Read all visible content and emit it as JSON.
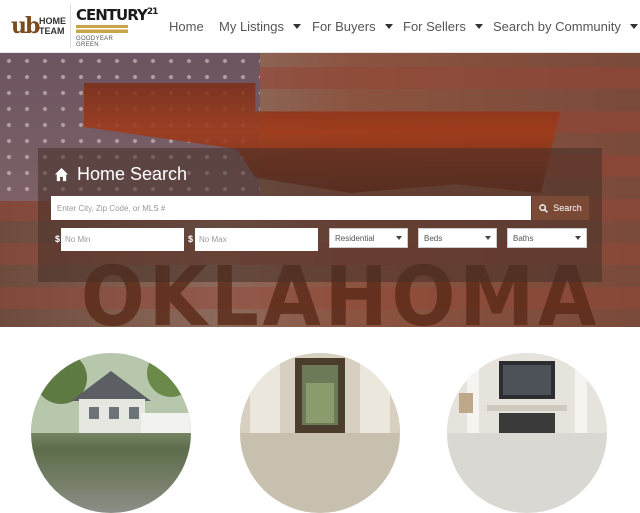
{
  "brand": {
    "ub_mark": "ub",
    "ub_line1": "HOME",
    "ub_line2": "TEAM",
    "c21_name": "CENTURY",
    "c21_number": "21",
    "c21_sub": "GOODYEAR GREEN"
  },
  "nav": {
    "items": [
      {
        "label": "Home",
        "has_dropdown": false
      },
      {
        "label": "My Listings",
        "has_dropdown": true
      },
      {
        "label": "For Buyers",
        "has_dropdown": true
      },
      {
        "label": "For Sellers",
        "has_dropdown": true
      },
      {
        "label": "Search by Community",
        "has_dropdown": true
      }
    ]
  },
  "hero": {
    "background_word": "OKLAHOMA"
  },
  "search": {
    "title": "Home Search",
    "placeholder": "Enter City, Zip Code, or MLS #",
    "button_label": "Search",
    "currency_symbol": "$",
    "min_placeholder": "No Min",
    "max_placeholder": "No Max",
    "property_type": "Residential",
    "beds": "Beds",
    "baths": "Baths"
  },
  "colors": {
    "accent": "#7b4a36",
    "panel_overlay": "rgba(70, 48, 40, 0.55)",
    "nav_text": "#555555"
  },
  "icons": {
    "home": "home-icon",
    "search": "search-icon",
    "dropdown": "caret-down-icon"
  },
  "features": [
    {
      "image": "house-exterior-photo"
    },
    {
      "image": "front-door-photo"
    },
    {
      "image": "fireplace-interior-photo"
    }
  ]
}
